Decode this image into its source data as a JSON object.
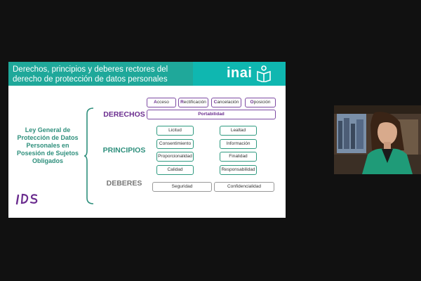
{
  "slide": {
    "title": "Derechos, principios y deberes rectores del derecho de protección de datos personales",
    "logo_text": "inai",
    "law_text": "Ley General de Protección de Datos Personales en Posesión de Sujetos Obligados",
    "footer_logo_text": "iDS",
    "rows": {
      "derechos": "DERECHOS",
      "principios": "PRINCIPIOS",
      "deberes": "DEBERES"
    },
    "derechos": [
      {
        "initial": "A",
        "rest": "cceso"
      },
      {
        "initial": "R",
        "rest": "ectificación"
      },
      {
        "initial": "C",
        "rest": "ancelación"
      },
      {
        "initial": "O",
        "rest": "posición"
      }
    ],
    "portabilidad": "Portabilidad",
    "principios_left": [
      "Licitud",
      "Consentimiento",
      "Proporcionalidad",
      "Calidad"
    ],
    "principios_right": [
      "Lealtad",
      "Información",
      "Finalidad",
      "Responsabilidad"
    ],
    "deberes": [
      "Seguridad",
      "Confidencialidad"
    ]
  },
  "colors": {
    "header": "#1fa89a",
    "purple": "#6b2d8f",
    "green": "#2e8f7c"
  }
}
